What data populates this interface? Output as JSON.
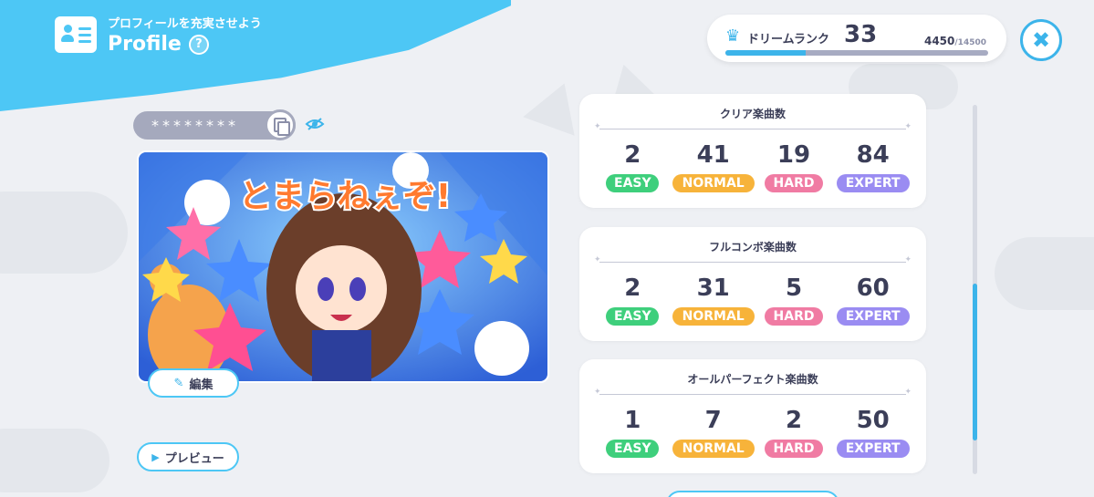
{
  "header": {
    "subtitle": "プロフィールを充実させよう",
    "title": "Profile",
    "help": "?"
  },
  "rank": {
    "label": "ドリームランク",
    "level": "33",
    "current": "4450",
    "max": "/14500",
    "progress": 0.307
  },
  "close": "✖",
  "password": {
    "masked": "********"
  },
  "buttons": {
    "edit": "編集",
    "preview": "プレビュー"
  },
  "card_image": {
    "caption": "とまらねぇぞ!"
  },
  "difficulties": {
    "easy": "EASY",
    "normal": "NORMAL",
    "hard": "HARD",
    "expert": "EXPERT"
  },
  "colors": {
    "easy": "#3ecf7c",
    "normal": "#f7b33a",
    "hard": "#f07ba3",
    "expert": "#9a8cf2",
    "accent": "#3cb4ea"
  },
  "stats": [
    {
      "title": "クリア楽曲数",
      "values": [
        "2",
        "41",
        "19",
        "84"
      ]
    },
    {
      "title": "フルコンボ楽曲数",
      "values": [
        "2",
        "31",
        "5",
        "60"
      ]
    },
    {
      "title": "オールパーフェクト楽曲数",
      "values": [
        "1",
        "7",
        "2",
        "50"
      ]
    }
  ]
}
